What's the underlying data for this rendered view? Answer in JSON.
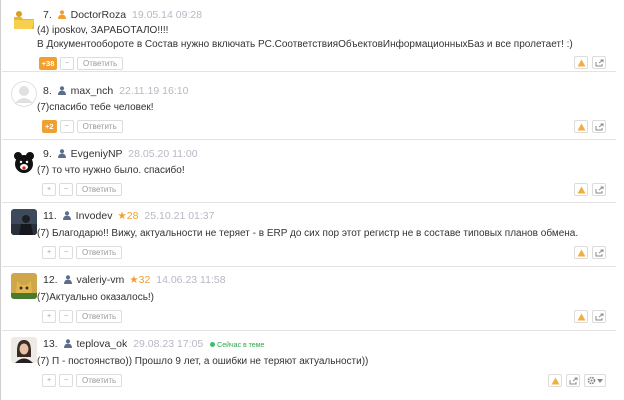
{
  "comments": [
    {
      "num": "7.",
      "user": "DoctorRoza",
      "user_color": "#f0a030",
      "date": "19.05.14 09:28",
      "rank": "",
      "lines": [
        "(4) iposkov, ЗАРАБОТАЛО!!!!",
        "В Документообороте в Состав нужно включать РС.СоответствияОбъектовИнформационныхБаз и все пролетает! :)"
      ],
      "score": "+38",
      "avatar": "folder-avatar"
    },
    {
      "num": "8.",
      "user": "max_nch",
      "user_color": "#5b6e8e",
      "date": "22.11.19 16:10",
      "rank": "",
      "lines": [
        "(7)спасибо тебе человек!"
      ],
      "score": "+2",
      "avatar": "default-avatar"
    },
    {
      "num": "9.",
      "user": "EvgeniyNP",
      "user_color": "#5b6e8e",
      "date": "28.05.20 11:00",
      "rank": "",
      "lines": [
        "(7) то что нужно было. спасибо!"
      ],
      "score": "",
      "avatar": "bear-avatar"
    },
    {
      "num": "11.",
      "user": "Invodev",
      "user_color": "#5b6e8e",
      "date": "25.10.21 01:37",
      "rank": "28",
      "lines": [
        "(7) Благодарю!! Вижу, актуальности не теряет - в ERP до сих пор этот регистр не в составе типовых планов обмена."
      ],
      "score": "",
      "avatar": "photo-avatar"
    },
    {
      "num": "12.",
      "user": "valeriy-vm",
      "user_color": "#5b6e8e",
      "date": "14.06.23 11:58",
      "rank": "32",
      "lines": [
        "(7)Актуально оказалось!)"
      ],
      "score": "",
      "avatar": "cat-avatar"
    },
    {
      "num": "13.",
      "user": "teplova_ok",
      "user_color": "#5b6e8e",
      "date": "29.08.23 17:05",
      "rank": "",
      "online": "Сейчас в теме",
      "lines": [
        "(7) П - постоянство)) Прошло 9 лет, а ошибки не теряют актуальности))"
      ],
      "score": "",
      "avatar": "woman-avatar"
    }
  ],
  "labels": {
    "reply": "Ответить",
    "plus": "+",
    "minus": "−"
  },
  "colors": {
    "accent": "#f0a030",
    "date": "#b8b8c6",
    "online": "#36c26a"
  }
}
